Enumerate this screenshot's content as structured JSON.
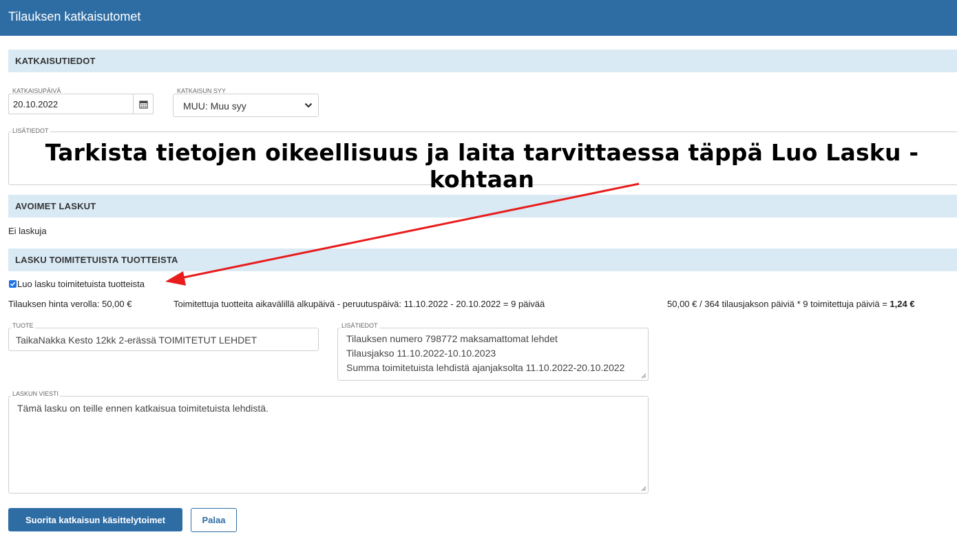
{
  "header": {
    "title": "Tilauksen katkaisutomet"
  },
  "sections": {
    "katkaisutiedot": "KATKAISUTIEDOT",
    "avoimet_laskut": "AVOIMET LASKUT",
    "lasku_toimitetuista": "LASKU TOIMITETUISTA TUOTTEISTA"
  },
  "katkaisu": {
    "date_label": "KATKAISUPÄIVÄ",
    "date_value": "20.10.2022",
    "reason_label": "KATKAISUN SYY",
    "reason_value": "MUU: Muu syy",
    "extra_label": "LISÄTIEDOT",
    "extra_value": ""
  },
  "annotation": {
    "text": "Tarkista tietojen oikeellisuus ja laita tarvittaessa täppä Luo Lasku - kohtaan"
  },
  "avoimet": {
    "empty_text": "Ei laskuja"
  },
  "lasku": {
    "checkbox_label": "Luo lasku toimitetuista tuotteista",
    "checkbox_checked": true,
    "price_text": "Tilauksen hinta verolla: 50,00 €",
    "period_text": "Toimitettuja tuotteita aikavälillä alkupäivä - peruutuspäivä: 11.10.2022 - 20.10.2022 = 9 päivää",
    "calc_text": "50,00 € / 364 tilausjakson päiviä * 9 toimitettuja päiviä = ",
    "calc_result": "1,24 €",
    "product_label": "TUOTE",
    "product_value": "TaikaNakka Kesto 12kk 2-erässä TOIMITETUT LEHDET",
    "notes_label": "LISÄTIEDOT",
    "notes_lines": [
      "Tilauksen numero 798772 maksamattomat lehdet",
      "Tilausjakso 11.10.2022-10.10.2023",
      "Summa toimitetuista lehdistä ajanjaksolta 11.10.2022-20.10.2022"
    ],
    "message_label": "LASKUN VIESTI",
    "message_value": "Tämä lasku on teille ennen katkaisua toimitetuista lehdistä."
  },
  "buttons": {
    "submit": "Suorita katkaisun käsittelytoimet",
    "back": "Palaa"
  },
  "colors": {
    "brand": "#2e6da4",
    "section_bg": "#d9eaf5",
    "arrow": "#e81c1c"
  }
}
